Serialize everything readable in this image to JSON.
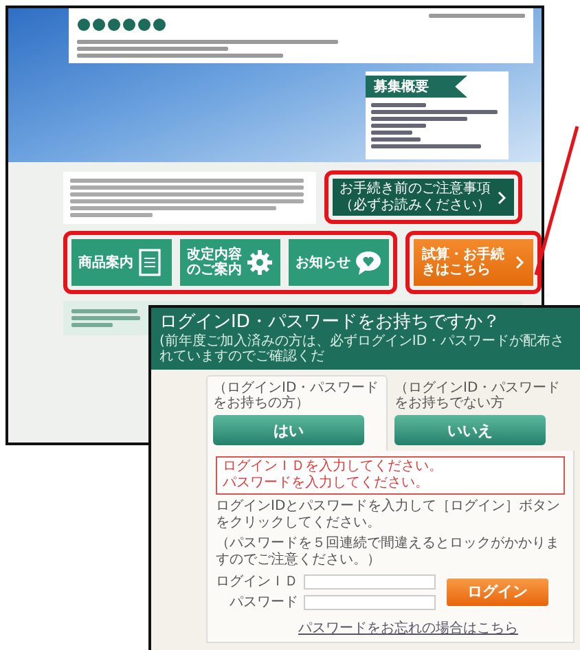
{
  "back_page": {
    "recruitment_card": {
      "title": "募集概要"
    },
    "notice_button": {
      "lines": [
        "お手続き前のご注意事項",
        "（必ずお読みください）"
      ]
    },
    "nav_buttons": [
      {
        "label": "商品案内",
        "kind": "document"
      },
      {
        "label": "改定内容のご案内",
        "kind": "gear"
      },
      {
        "label": "お知らせ",
        "kind": "speech"
      }
    ],
    "quote_button": {
      "label": "試算・お手続きはこちら"
    }
  },
  "login_dialog": {
    "title": "ログインID・パスワードをお持ちですか？",
    "subtitle": "(前年度ご加入済みの方は、必ずログインID・パスワードが配布されていますのでご確認くだ",
    "options": [
      {
        "tab_label": "（ログインID・パスワードをお持ちの方）",
        "button_label": "はい",
        "selected": true
      },
      {
        "tab_label": "（ログインID・パスワードをお持ちでない方",
        "button_label": "いいえ",
        "selected": false
      }
    ],
    "errors": [
      "ログインＩＤを入力してください。",
      "パスワードを入力してください。"
    ],
    "instructions": [
      "ログインIDとパスワードを入力して［ログイン］ボタンをクリックしてください。",
      "（パスワードを５回連続で間違えるとロックがかかりますのでご注意ください。）"
    ],
    "fields": [
      {
        "label": "ログインＩＤ"
      },
      {
        "label": "パスワード"
      }
    ],
    "login_button": "ログイン",
    "forgot_link": "パスワードをお忘れの場合はこちら"
  }
}
